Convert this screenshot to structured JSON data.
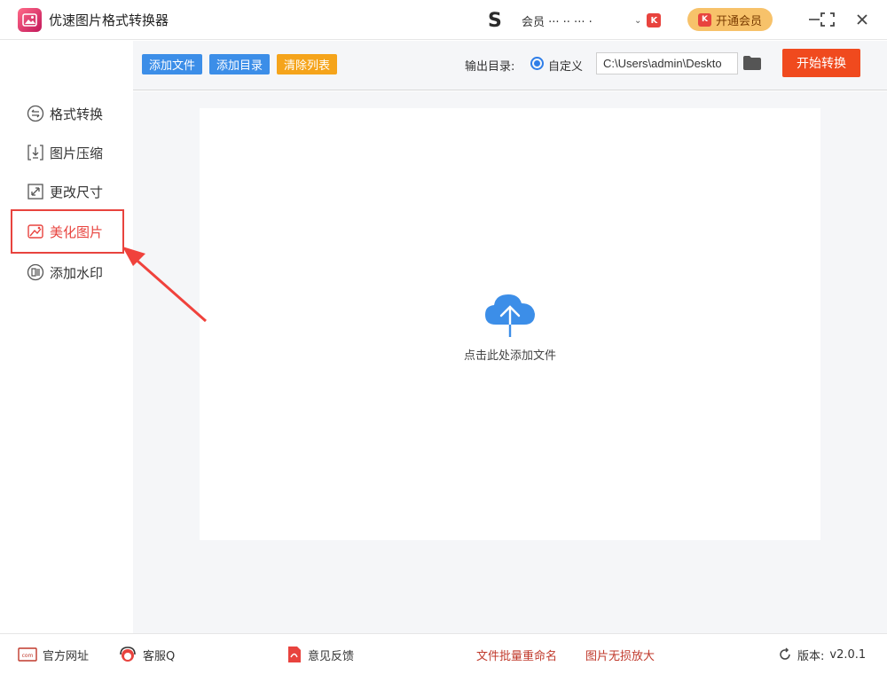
{
  "app": {
    "title": "优速图片格式转换器"
  },
  "user": {
    "logo_letter": "S",
    "label": "会员 ··· ·· ··· ·",
    "badge": "K"
  },
  "vip": {
    "label": "开通会员",
    "icon": "K"
  },
  "window": {
    "minimize": "—",
    "maximize": "⛶",
    "close": "✕"
  },
  "sidebar": {
    "items": [
      {
        "label": "格式转换",
        "icon": "convert-icon"
      },
      {
        "label": "图片压缩",
        "icon": "compress-icon"
      },
      {
        "label": "更改尺寸",
        "icon": "resize-icon"
      },
      {
        "label": "美化图片",
        "icon": "beautify-icon",
        "active": true
      },
      {
        "label": "添加水印",
        "icon": "watermark-icon"
      }
    ]
  },
  "toolbar": {
    "add_file": "添加文件",
    "add_dir": "添加目录",
    "clear_list": "清除列表",
    "output_label": "输出目录:",
    "custom_label": "自定义",
    "path_value": "C:\\Users\\admin\\Deskto",
    "start": "开始转换"
  },
  "main": {
    "drop_hint": "点击此处添加文件"
  },
  "footer": {
    "website": "官方网址",
    "service": "客服Q",
    "feedback": "意见反馈",
    "batch_rename": "文件批量重命名",
    "enlarge": "图片无损放大",
    "version_label": "版本:",
    "version": "v2.0.1"
  },
  "colors": {
    "accent_blue": "#3c8ee8",
    "accent_orange": "#f5a41b",
    "accent_red": "#e8433e",
    "start_button": "#f04a1e"
  }
}
